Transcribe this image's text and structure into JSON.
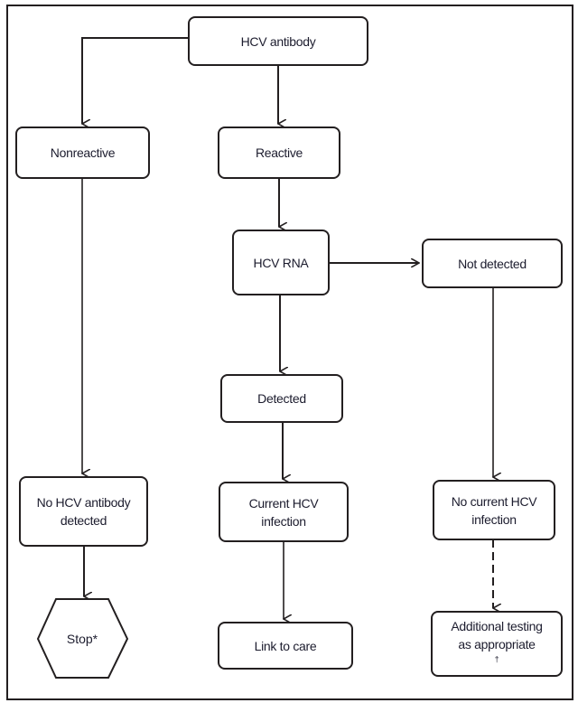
{
  "diagram": {
    "nodes": {
      "hcv_antibody": {
        "label": "HCV antibody"
      },
      "nonreactive": {
        "label": "Nonreactive"
      },
      "reactive": {
        "label": "Reactive"
      },
      "hcv_rna": {
        "label": "HCV RNA"
      },
      "not_detected": {
        "label": "Not detected"
      },
      "detected": {
        "label": "Detected"
      },
      "no_antibody": {
        "line1": "No HCV antibody",
        "line2": "detected"
      },
      "current_infection": {
        "line1": "Current HCV",
        "line2": "infection"
      },
      "no_current_infection": {
        "line1": "No current HCV",
        "line2": "infection"
      },
      "stop": {
        "label": "Stop",
        "footnote_mark": "*"
      },
      "link_to_care": {
        "label": "Link to care"
      },
      "additional_testing": {
        "line1": "Additional testing",
        "line2": "as appropriate",
        "footnote_mark": "†"
      }
    },
    "edges": [
      {
        "from": "HCV antibody",
        "to": "Nonreactive",
        "style": "solid"
      },
      {
        "from": "HCV antibody",
        "to": "Reactive",
        "style": "solid"
      },
      {
        "from": "Reactive",
        "to": "HCV RNA",
        "style": "solid"
      },
      {
        "from": "HCV RNA",
        "to": "Not detected",
        "style": "solid"
      },
      {
        "from": "HCV RNA",
        "to": "Detected",
        "style": "solid"
      },
      {
        "from": "Nonreactive",
        "to": "No HCV antibody detected",
        "style": "solid"
      },
      {
        "from": "Detected",
        "to": "Current HCV infection",
        "style": "solid"
      },
      {
        "from": "Not detected",
        "to": "No current HCV infection",
        "style": "solid"
      },
      {
        "from": "No HCV antibody detected",
        "to": "Stop",
        "style": "solid"
      },
      {
        "from": "Current HCV infection",
        "to": "Link to care",
        "style": "solid"
      },
      {
        "from": "No current HCV infection",
        "to": "Additional testing as appropriate",
        "style": "dashed"
      }
    ],
    "colors": {
      "line": "#231f20",
      "text": "#1c1c2e",
      "background": "#ffffff"
    }
  }
}
